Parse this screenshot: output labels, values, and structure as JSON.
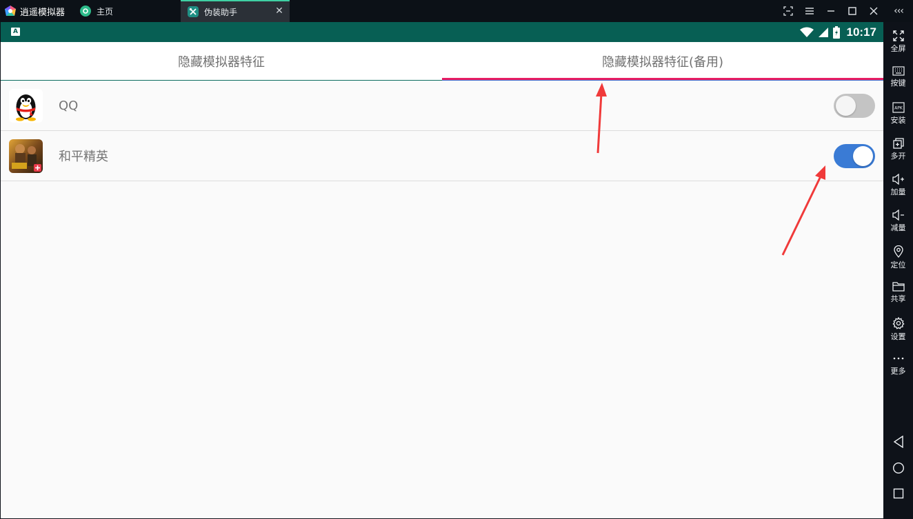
{
  "window": {
    "app_title": "逍遥模拟器",
    "tabs": [
      {
        "label": "主页",
        "icon": "home-app-icon"
      },
      {
        "label": "伪装助手",
        "icon": "disguise-helper-icon"
      }
    ],
    "collapse_label": "‹‹‹"
  },
  "statusbar": {
    "input_badge": "A",
    "time": "10:17"
  },
  "page_tabs": [
    {
      "label": "隐藏模拟器特征",
      "selected": false
    },
    {
      "label": "隐藏模拟器特征(备用)",
      "selected": true
    }
  ],
  "apps": [
    {
      "name": "QQ",
      "icon": "qq-penguin-icon",
      "enabled": false
    },
    {
      "name": "和平精英",
      "icon": "peace-elite-game-icon",
      "enabled": true
    }
  ],
  "sidebar": {
    "items": [
      {
        "label": "全屏",
        "icon": "fullscreen-icon"
      },
      {
        "label": "按键",
        "icon": "keyboard-icon"
      },
      {
        "label": "安装",
        "icon": "apk-install-icon"
      },
      {
        "label": "多开",
        "icon": "multi-instance-icon"
      },
      {
        "label": "加量",
        "icon": "volume-up-icon"
      },
      {
        "label": "减量",
        "icon": "volume-down-icon"
      },
      {
        "label": "定位",
        "icon": "location-pin-icon"
      },
      {
        "label": "共享",
        "icon": "folder-icon"
      },
      {
        "label": "设置",
        "icon": "gear-icon"
      },
      {
        "label": "更多",
        "icon": "more-dots-icon"
      }
    ],
    "nav": [
      "back-icon",
      "home-circle-icon",
      "recents-square-icon"
    ]
  },
  "colors": {
    "statusbar": "#075f54",
    "tab_indicator": "#e91e63",
    "switch_on": "#3a7bd5",
    "switch_off": "#c4c4c4",
    "annotation_arrow": "#f03a3a"
  }
}
